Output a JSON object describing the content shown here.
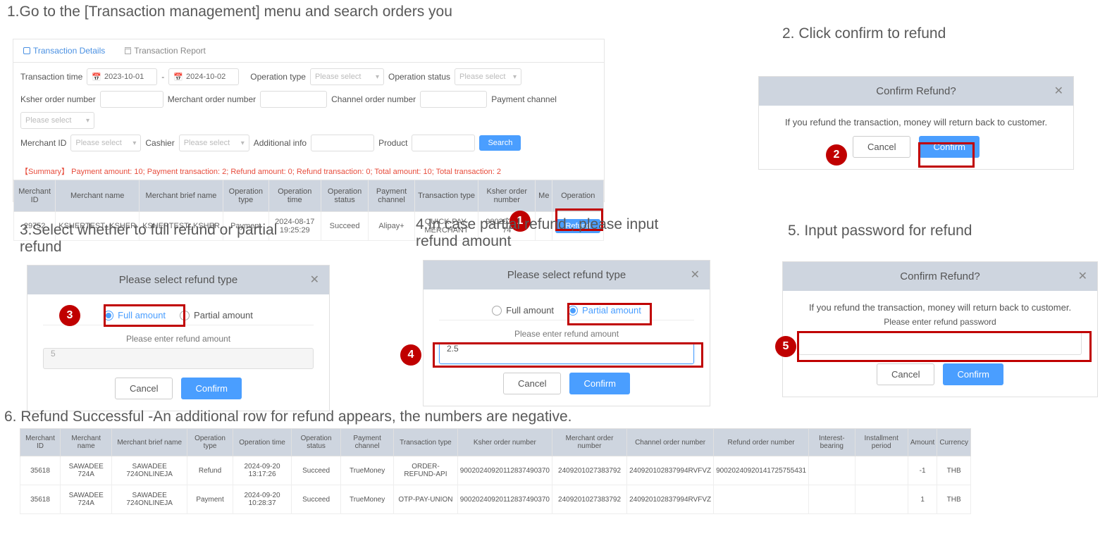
{
  "steps": {
    "s1": "1.Go to the [Transaction management] menu and search orders you",
    "s2": "2. Click confirm to refund",
    "s3": "3.Select whether to full refund or partial refund",
    "s4": "4.In case partial refund , please input refund amount",
    "s5": "5. Input password for refund",
    "s6": "6. Refund Successful  -An additional row for refund appears, the numbers are negative."
  },
  "panel1": {
    "tab_details": "Transaction Details",
    "tab_report": "Transaction Report",
    "labels": {
      "txn_time": "Transaction time",
      "op_type": "Operation type",
      "op_status": "Operation status",
      "ksher_order": "Ksher order number",
      "merchant_order": "Merchant order number",
      "channel_order": "Channel order number",
      "payment_channel": "Payment channel",
      "merchant_id": "Merchant ID",
      "cashier": "Cashier",
      "additional": "Additional info",
      "product": "Product",
      "please_select": "Please select",
      "search": "Search",
      "date_from": "2023-10-01",
      "date_to": "2024-10-02",
      "dash": "-"
    },
    "summary": "【Summary】 Payment amount:  10;   Payment transaction:  2;  Refund amount:  0;   Refund transaction:  0;   Total amount:  10;   Total transaction:  2",
    "headers": [
      "Merchant ID",
      "Merchant name",
      "Merchant brief name",
      "Operation type",
      "Operation time",
      "Operation status",
      "Payment channel",
      "Transaction type",
      "Ksher order number",
      "Me",
      "Operation"
    ],
    "row": {
      "mid": "29752",
      "mname": "KSHERTEST_KSHER",
      "mbrief": "KSHERTEST_KSHER",
      "otype": "Payment",
      "otime": "2024-08-17 19:25:29",
      "ostatus": "Succeed",
      "channel": "Alipay+",
      "ttype": "QUICK-PAY-MERCHANT",
      "korder": "90020240… 74",
      "refund": "Refund"
    }
  },
  "modal_confirm": {
    "title": "Confirm Refund?",
    "body": "If you refund the transaction, money will return back to customer.",
    "cancel": "Cancel",
    "confirm": "Confirm"
  },
  "modal_type": {
    "title": "Please select refund type",
    "full": "Full amount",
    "partial": "Partial amount",
    "enter": "Please enter refund amount",
    "val_full": "5",
    "val_partial": "2.5",
    "cancel": "Cancel",
    "confirm": "Confirm"
  },
  "modal_pw": {
    "title": "Confirm Refund?",
    "l1": "If you refund the transaction, money will return back to customer.",
    "l2": "Please enter refund password",
    "cancel": "Cancel",
    "confirm": "Confirm"
  },
  "panel6": {
    "headers": [
      "Merchant ID",
      "Merchant name",
      "Merchant brief name",
      "Operation type",
      "Operation time",
      "Operation status",
      "Payment channel",
      "Transaction type",
      "Ksher order number",
      "Merchant order number",
      "Channel order number",
      "Refund order number",
      "Interest-bearing",
      "Installment period",
      "Amount",
      "Currency"
    ],
    "rows": [
      {
        "c": [
          "35618",
          "SAWADEE 724A",
          "SAWADEE 724ONLINEJA",
          "Refund",
          "2024-09-20 13:17:26",
          "Succeed",
          "TrueMoney",
          "ORDER-REFUND-API",
          "90020240920112837490370",
          "2409201027383792",
          "240920102837994RVFVZ",
          "90020240920141725755431",
          "",
          "",
          "-1",
          "THB"
        ]
      },
      {
        "c": [
          "35618",
          "SAWADEE 724A",
          "SAWADEE 724ONLINEJA",
          "Payment",
          "2024-09-20 10:28:37",
          "Succeed",
          "TrueMoney",
          "OTP-PAY-UNION",
          "90020240920112837490370",
          "2409201027383792",
          "240920102837994RVFVZ",
          "",
          "",
          "",
          "1",
          "THB"
        ]
      }
    ]
  },
  "badges": {
    "b1": "1",
    "b2": "2",
    "b3": "3",
    "b4": "4",
    "b5": "5"
  }
}
